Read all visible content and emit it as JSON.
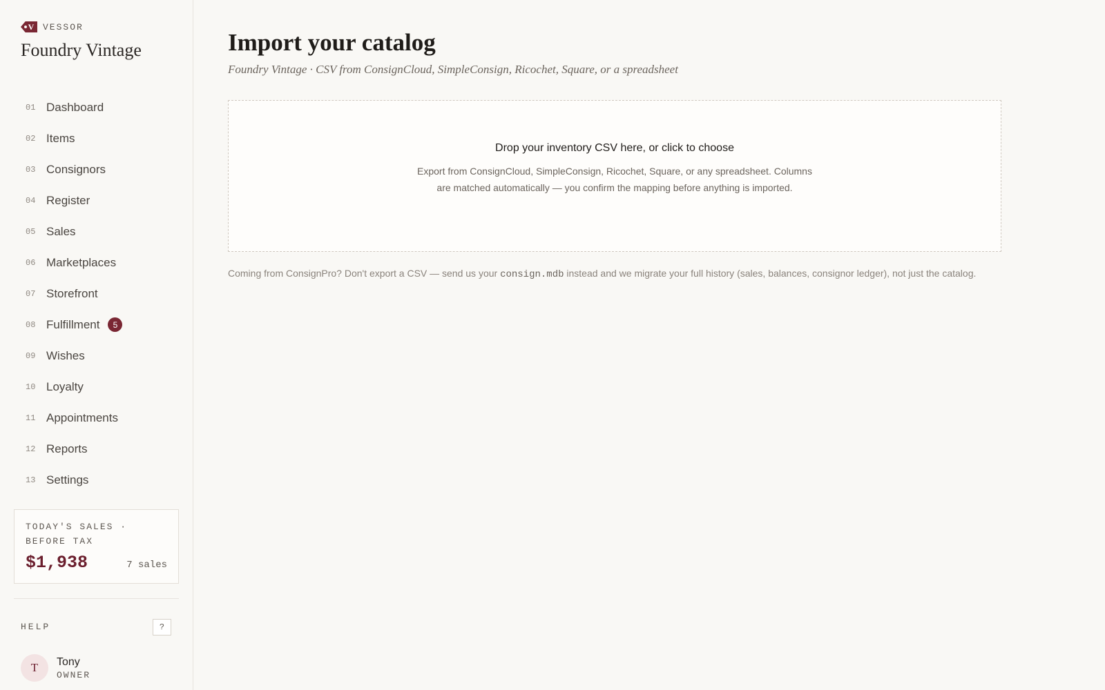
{
  "brand": {
    "logo_letter": "V",
    "name": "VESSOR",
    "store": "Foundry Vintage"
  },
  "nav": [
    {
      "num": "01",
      "label": "Dashboard"
    },
    {
      "num": "02",
      "label": "Items"
    },
    {
      "num": "03",
      "label": "Consignors"
    },
    {
      "num": "04",
      "label": "Register"
    },
    {
      "num": "05",
      "label": "Sales"
    },
    {
      "num": "06",
      "label": "Marketplaces"
    },
    {
      "num": "07",
      "label": "Storefront"
    },
    {
      "num": "08",
      "label": "Fulfillment",
      "badge": "5"
    },
    {
      "num": "09",
      "label": "Wishes"
    },
    {
      "num": "10",
      "label": "Loyalty"
    },
    {
      "num": "11",
      "label": "Appointments"
    },
    {
      "num": "12",
      "label": "Reports"
    },
    {
      "num": "13",
      "label": "Settings"
    }
  ],
  "sales_card": {
    "title": "TODAY'S SALES · BEFORE TAX",
    "amount": "$1,938",
    "count": "7 sales"
  },
  "help": {
    "label": "HELP",
    "button": "?"
  },
  "user": {
    "initial": "T",
    "name": "Tony",
    "role": "OWNER"
  },
  "main": {
    "title": "Import your catalog",
    "subtitle": "Foundry Vintage · CSV from ConsignCloud, SimpleConsign, Ricochet, Square, or a spreadsheet",
    "dropzone": {
      "title": "Drop your inventory CSV here, or click to choose",
      "text": "Export from ConsignCloud, SimpleConsign, Ricochet, Square, or any spreadsheet. Columns are matched automatically — you confirm the mapping before anything is imported."
    },
    "note": {
      "before": "Coming from ConsignPro? Don't export a CSV — send us your ",
      "code": "consign.mdb",
      "after": " instead and we migrate your full history (sales, balances, consignor ledger), not just the catalog."
    }
  },
  "colors": {
    "accent": "#7a2733",
    "background": "#f9f8f5"
  }
}
